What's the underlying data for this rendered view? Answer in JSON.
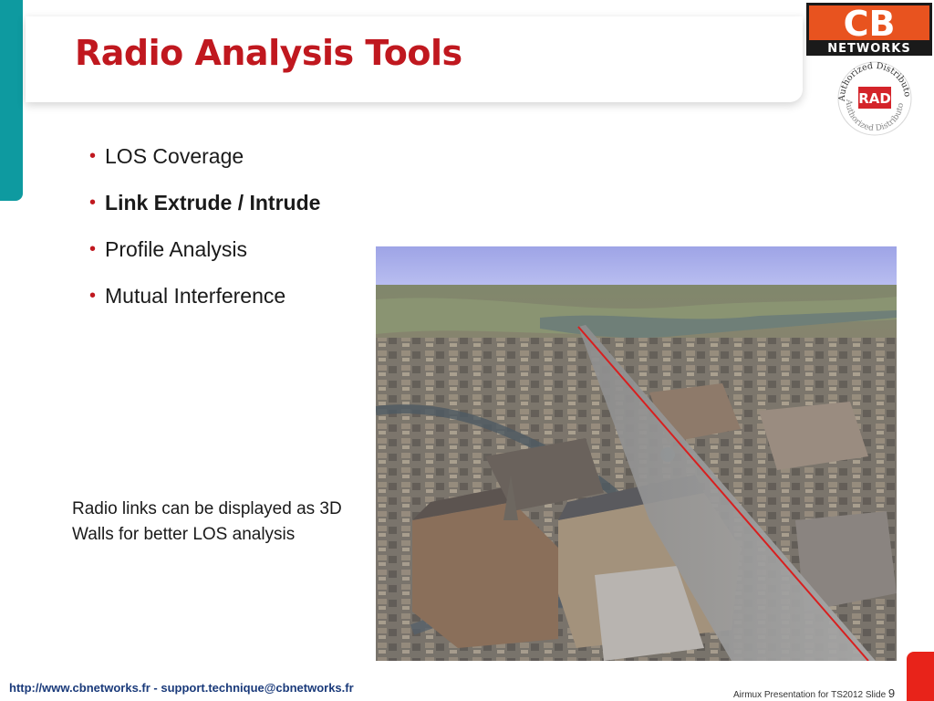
{
  "slide": {
    "title": "Radio Analysis Tools",
    "bullets": [
      {
        "text": "LOS Coverage",
        "bold": false
      },
      {
        "text": "Link Extrude / Intrude",
        "bold": true
      },
      {
        "text": "Profile Analysis",
        "bold": false
      },
      {
        "text": "Mutual Interference",
        "bold": false
      }
    ],
    "caption_line1": "Radio links can be displayed as 3D",
    "caption_line2": "Walls for better LOS analysis"
  },
  "logo": {
    "brand_top": "CB",
    "brand_bottom": "NETWORKS",
    "seal_ring_text": "Authorized Distributor",
    "seal_center": "RAD",
    "colors": {
      "brand_orange": "#e8531f",
      "brand_black": "#1a1a1a",
      "rad_red": "#d4242a"
    }
  },
  "footer": {
    "left": "http://www.cbnetworks.fr - support.technique@cbnetworks.fr",
    "right_text": "Airmux Presentation for TS2012 Slide",
    "page_number": "9"
  },
  "image": {
    "icon": "3d-city-map-icon",
    "description_alt": "3D city link wall view"
  },
  "colors": {
    "title_red": "#c0181f",
    "teal_accent": "#0e9aa0"
  }
}
